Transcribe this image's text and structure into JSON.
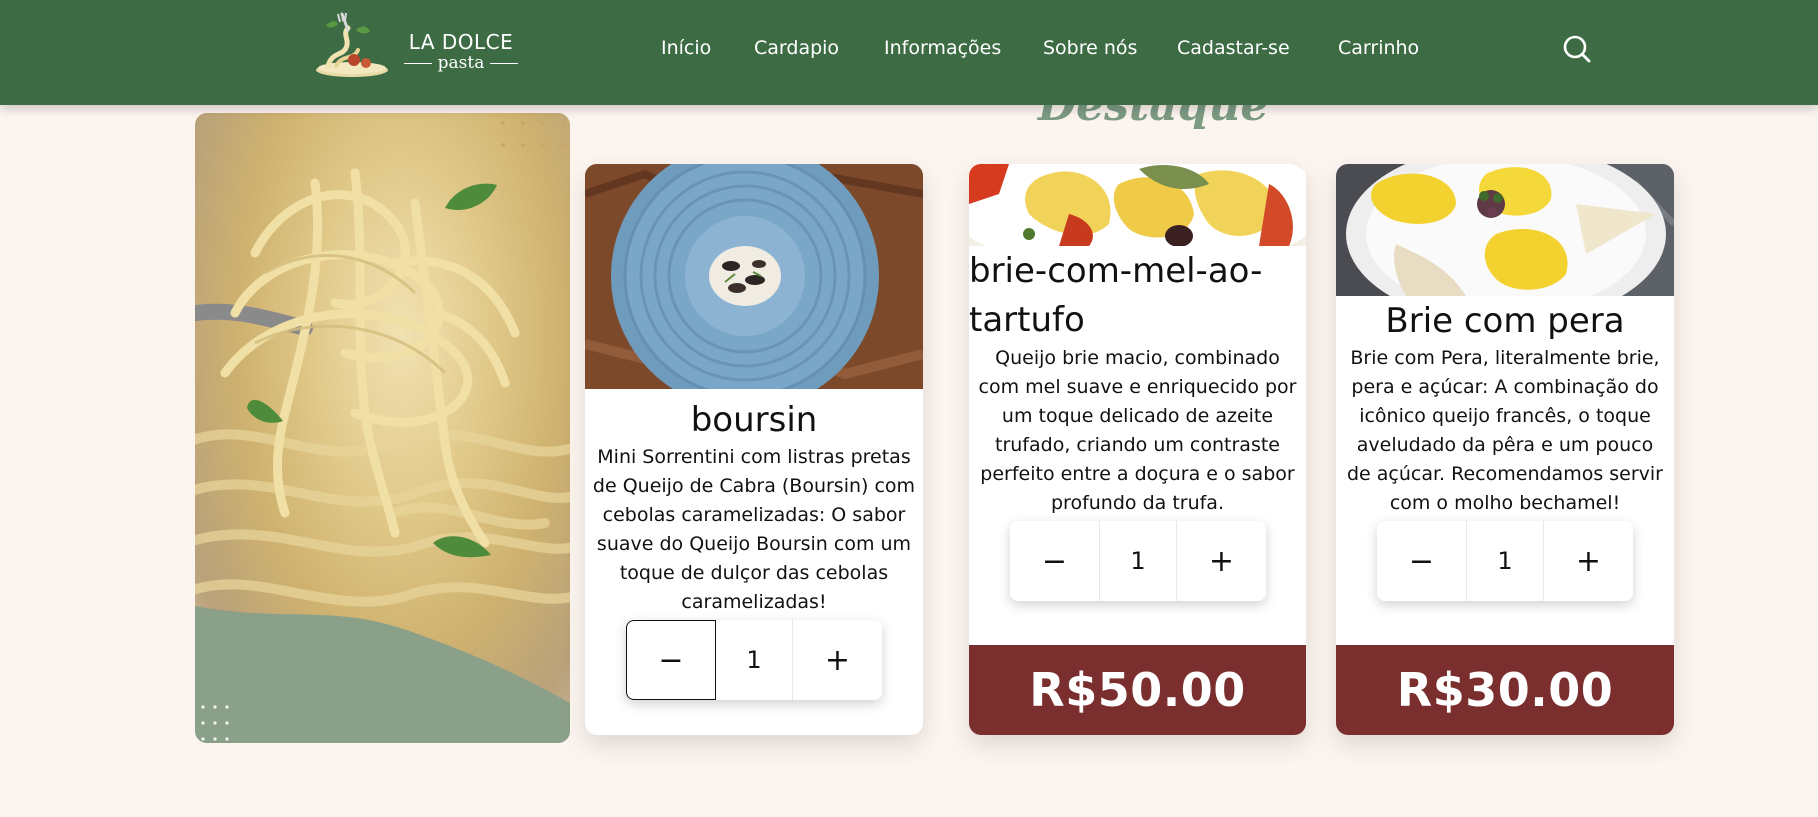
{
  "brand": {
    "title": "LA DOLCE",
    "subtitle": "pasta"
  },
  "nav": {
    "items": [
      {
        "label": "Início"
      },
      {
        "label": "Cardapio"
      },
      {
        "label": "Informações"
      },
      {
        "label": "Sobre nós"
      },
      {
        "label": "Cadastar-se"
      },
      {
        "label": "Carrinho"
      }
    ],
    "search_icon": "search-icon"
  },
  "section": {
    "title": "Destaque"
  },
  "products": [
    {
      "name": "boursin",
      "description": "Mini Sorrentini com listras pretas de Queijo de Cabra (Boursin) com cebolas caramelizadas: O sabor suave do Queijo Boursin com um toque de dulçor das cebolas caramelizadas!",
      "quantity": "1",
      "minus": "−",
      "plus": "+",
      "price": ""
    },
    {
      "name": "brie-com-mel-ao-tartufo",
      "description": "Queijo brie macio, combinado com mel suave e enriquecido por um toque delicado de azeite trufado, criando um contraste perfeito entre a doçura e o sabor profundo da trufa.",
      "quantity": "1",
      "minus": "−",
      "plus": "+",
      "price": "R$50.00"
    },
    {
      "name": "Brie com pera",
      "description": "Brie com Pera, literalmente brie, pera e açúcar: A combinação do icônico queijo francês, o toque aveludado da pêra e um pouco de açúcar. Recomendamos servir com o molho bechamel!",
      "quantity": "1",
      "minus": "−",
      "plus": "+",
      "price": "R$30.00"
    }
  ],
  "colors": {
    "header": "#3d6c44",
    "background": "#fcf4ee",
    "price_bar": "#7a2e2e",
    "accent_green": "#7d9b83"
  }
}
